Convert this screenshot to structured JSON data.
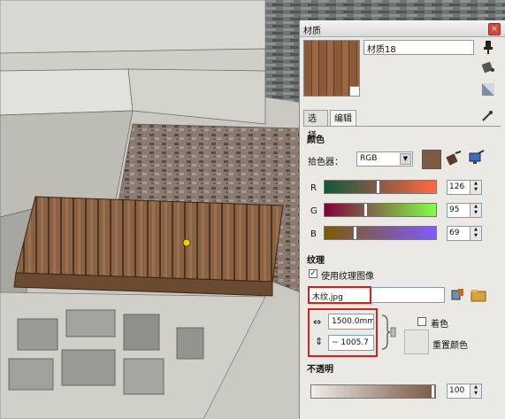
{
  "panel": {
    "title": "材质",
    "close_glyph": "×",
    "material_name": "材质18",
    "tabs": [
      {
        "label": "选择"
      },
      {
        "label": "编辑"
      }
    ],
    "color": {
      "heading": "颜色",
      "picker_label": "拾色器：",
      "picker_value": "RGB",
      "current_hex": "#7f5a45",
      "channels": [
        {
          "label": "R",
          "value": "126"
        },
        {
          "label": "G",
          "value": "95"
        },
        {
          "label": "B",
          "value": "69"
        }
      ]
    },
    "texture": {
      "heading": "纹理",
      "use_texture_label": "使用纹理图像",
      "use_texture_checked": "✓",
      "file_name": "木纹.jpg",
      "width_value": "1500.0mm",
      "height_value": "~ 1005.7",
      "colorize_label": "着色",
      "reset_color_label": "重置颜色"
    },
    "opacity": {
      "heading": "不透明",
      "value": "100"
    }
  },
  "icons": {
    "close": "close-icon",
    "pushpin": "pushpin-icon",
    "paint": "paint-bucket-icon",
    "eyedropper": "eyedropper-icon",
    "width": "width-arrows-icon",
    "height": "height-arrows-icon",
    "link": "link-aspect-icon",
    "texture_edit": "texture-edit-icon",
    "browse": "browse-folder-icon"
  },
  "colors": {
    "highlight_box": "#d6201a",
    "panel_bg": "#ebe9e4"
  }
}
